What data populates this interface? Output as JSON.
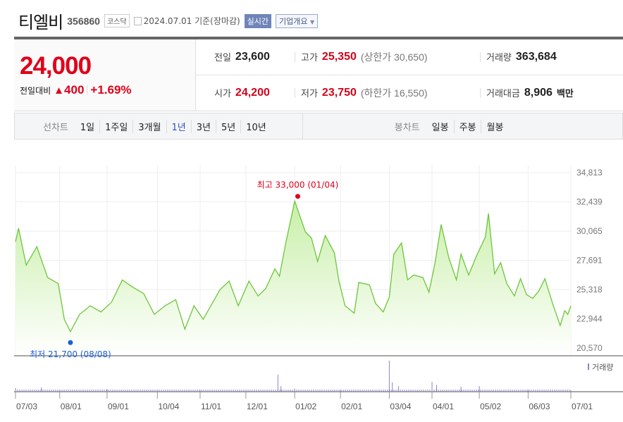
{
  "header": {
    "title": "티엘비",
    "code": "356860",
    "market": "코스닥",
    "date": "2024.07.01 기준(장마감)",
    "realtime_label": "실시간",
    "company_label": "기업개요"
  },
  "quote": {
    "price": "24,000",
    "change_label": "전일대비",
    "change": "400",
    "change_pct": "+1.69%",
    "up_color": "#e0001a",
    "prev_label": "전일",
    "prev": "23,600",
    "high_label": "고가",
    "high": "25,350",
    "upper_limit": "(상한가 30,650)",
    "volume_label": "거래량",
    "volume": "363,684",
    "open_label": "시가",
    "open": "24,200",
    "low_label": "저가",
    "low": "23,750",
    "lower_limit": "(하한가 16,550)",
    "amount_label": "거래대금",
    "amount": "8,906",
    "amount_unit": "백만"
  },
  "tabs": {
    "line_label": "선차트",
    "line": [
      "1일",
      "1주일",
      "3개월",
      "1년",
      "3년",
      "5년",
      "10년"
    ],
    "active": "1년",
    "candle_label": "봉차트",
    "candle": [
      "일봉",
      "주봉",
      "월봉"
    ]
  },
  "chart_data": {
    "type": "area",
    "line_color": "#6cc63a",
    "fill_color": "#c8efa8",
    "yticks": [
      "34,813",
      "32,439",
      "30,065",
      "27,691",
      "25,318",
      "22,944",
      "20,570"
    ],
    "ylim": [
      20570,
      34813
    ],
    "xticks": [
      "07/03",
      "08/01",
      "09/01",
      "10/04",
      "11/01",
      "12/01",
      "01/02",
      "02/01",
      "03/04",
      "04/01",
      "05/02",
      "06/03",
      "07/01"
    ],
    "xtick_dates": [
      "2023-07-03",
      "2023-08-01",
      "2023-09-01",
      "2023-10-04",
      "2023-11-01",
      "2023-12-01",
      "2024-01-02",
      "2024-02-01",
      "2024-03-04",
      "2024-04-01",
      "2024-05-02",
      "2024-06-03",
      "2024-07-01"
    ],
    "xlim": [
      "2023-07-03",
      "2024-07-01"
    ],
    "high_annotation": {
      "label": "최고 33,000 (01/04)",
      "date": "2024-01-04",
      "value": 33000,
      "color": "#e0001a"
    },
    "low_annotation": {
      "label": "최저 21,700 (08/08)",
      "date": "2023-08-08",
      "value": 21700,
      "color": "#1d5fd6"
    },
    "volume_label": "거래량",
    "points": [
      [
        "2023-07-03",
        29200
      ],
      [
        "2023-07-05",
        30300
      ],
      [
        "2023-07-10",
        27300
      ],
      [
        "2023-07-17",
        28800
      ],
      [
        "2023-07-24",
        26300
      ],
      [
        "2023-07-31",
        25800
      ],
      [
        "2023-08-04",
        22900
      ],
      [
        "2023-08-08",
        21900
      ],
      [
        "2023-08-14",
        23300
      ],
      [
        "2023-08-21",
        24000
      ],
      [
        "2023-08-28",
        23500
      ],
      [
        "2023-09-04",
        24300
      ],
      [
        "2023-09-11",
        26100
      ],
      [
        "2023-09-18",
        25500
      ],
      [
        "2023-09-25",
        25000
      ],
      [
        "2023-10-02",
        23300
      ],
      [
        "2023-10-09",
        24000
      ],
      [
        "2023-10-16",
        24500
      ],
      [
        "2023-10-22",
        22100
      ],
      [
        "2023-10-28",
        24000
      ],
      [
        "2023-11-03",
        22900
      ],
      [
        "2023-11-08",
        24000
      ],
      [
        "2023-11-14",
        25300
      ],
      [
        "2023-11-20",
        26000
      ],
      [
        "2023-11-26",
        24000
      ],
      [
        "2023-12-03",
        26000
      ],
      [
        "2023-12-09",
        24800
      ],
      [
        "2023-12-14",
        25400
      ],
      [
        "2023-12-20",
        27000
      ],
      [
        "2023-12-23",
        26400
      ],
      [
        "2023-12-27",
        29000
      ],
      [
        "2024-01-02",
        32500
      ],
      [
        "2024-01-09",
        30000
      ],
      [
        "2024-01-13",
        29500
      ],
      [
        "2024-01-17",
        27600
      ],
      [
        "2024-01-22",
        29700
      ],
      [
        "2024-01-28",
        28300
      ],
      [
        "2024-01-31",
        26000
      ],
      [
        "2024-02-04",
        24000
      ],
      [
        "2024-02-10",
        23400
      ],
      [
        "2024-02-13",
        25900
      ],
      [
        "2024-02-20",
        25700
      ],
      [
        "2024-02-24",
        24200
      ],
      [
        "2024-02-29",
        23500
      ],
      [
        "2024-03-04",
        24700
      ],
      [
        "2024-03-07",
        28200
      ],
      [
        "2024-03-12",
        29100
      ],
      [
        "2024-03-16",
        26100
      ],
      [
        "2024-03-20",
        26500
      ],
      [
        "2024-03-26",
        26300
      ],
      [
        "2024-03-30",
        25100
      ],
      [
        "2024-04-03",
        27500
      ],
      [
        "2024-04-07",
        30600
      ],
      [
        "2024-04-12",
        27900
      ],
      [
        "2024-04-17",
        26100
      ],
      [
        "2024-04-20",
        28200
      ],
      [
        "2024-04-25",
        26500
      ],
      [
        "2024-04-30",
        28000
      ],
      [
        "2024-05-06",
        29600
      ],
      [
        "2024-05-08",
        31500
      ],
      [
        "2024-05-12",
        26600
      ],
      [
        "2024-05-16",
        27500
      ],
      [
        "2024-05-20",
        25800
      ],
      [
        "2024-05-25",
        24800
      ],
      [
        "2024-05-29",
        26200
      ],
      [
        "2024-06-02",
        24900
      ],
      [
        "2024-06-06",
        24600
      ],
      [
        "2024-06-10",
        25200
      ],
      [
        "2024-06-14",
        26200
      ],
      [
        "2024-06-19",
        24200
      ],
      [
        "2024-06-24",
        22400
      ],
      [
        "2024-06-27",
        23600
      ],
      [
        "2024-06-29",
        23300
      ],
      [
        "2024-07-01",
        24000
      ]
    ],
    "volume": [
      [
        "2023-07-03",
        0.12
      ],
      [
        "2023-07-20",
        0.14
      ],
      [
        "2023-08-01",
        0.06
      ],
      [
        "2023-09-01",
        0.08
      ],
      [
        "2023-10-04",
        0.04
      ],
      [
        "2023-11-01",
        0.04
      ],
      [
        "2023-12-01",
        0.05
      ],
      [
        "2023-12-22",
        0.55
      ],
      [
        "2023-12-24",
        0.18
      ],
      [
        "2024-01-02",
        0.1
      ],
      [
        "2024-02-01",
        0.05
      ],
      [
        "2024-03-04",
        1.0
      ],
      [
        "2024-03-06",
        0.3
      ],
      [
        "2024-03-10",
        0.18
      ],
      [
        "2024-04-01",
        0.32
      ],
      [
        "2024-04-04",
        0.22
      ],
      [
        "2024-04-20",
        0.16
      ],
      [
        "2024-05-02",
        0.18
      ],
      [
        "2024-06-03",
        0.05
      ],
      [
        "2024-07-01",
        0.05
      ]
    ]
  }
}
